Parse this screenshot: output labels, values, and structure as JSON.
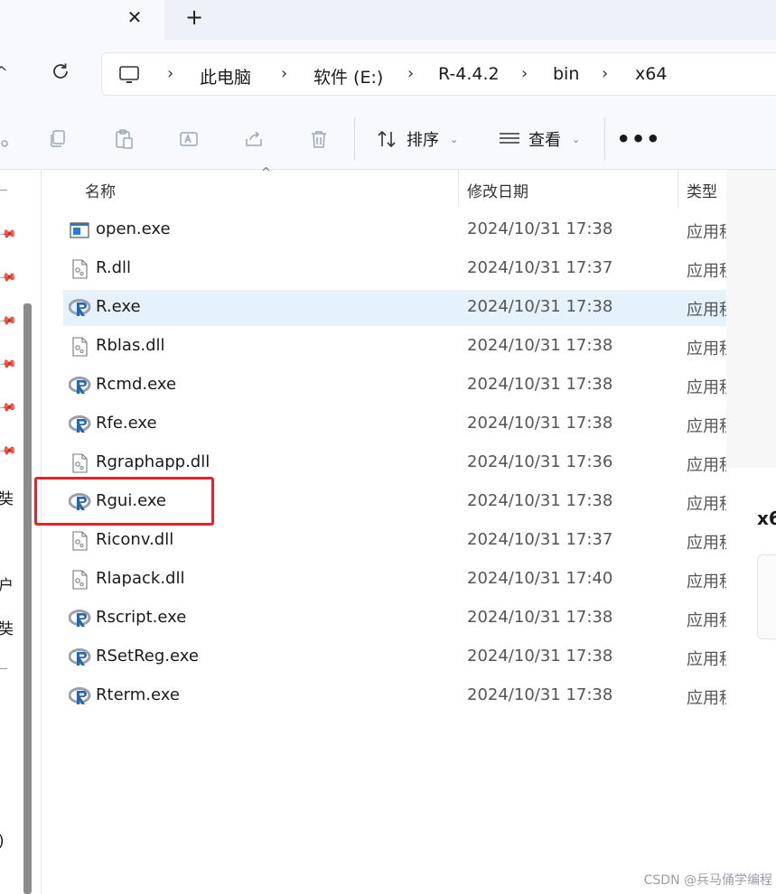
{
  "tabs": {
    "close_glyph": "✕",
    "new_tab_glyph": "+"
  },
  "address": {
    "left_fragment": "^",
    "breadcrumb": [
      "此电脑",
      "软件 (E:)",
      "R-4.4.2",
      "bin",
      "x64"
    ],
    "separator": "›"
  },
  "toolbar": {
    "sort_label": "排序",
    "view_label": "查看",
    "more_label": "•••"
  },
  "columns": {
    "name": "名称",
    "modified": "修改日期",
    "type": "类型"
  },
  "files": [
    {
      "name": "open.exe",
      "date": "2024/10/31 17:38",
      "type": "应用程序",
      "icon": "exe-window-icon"
    },
    {
      "name": "R.dll",
      "date": "2024/10/31 17:37",
      "type": "应用程序",
      "icon": "dll-icon"
    },
    {
      "name": "R.exe",
      "date": "2024/10/31 17:38",
      "type": "应用程序",
      "icon": "r-logo-icon",
      "selected": true
    },
    {
      "name": "Rblas.dll",
      "date": "2024/10/31 17:38",
      "type": "应用程序",
      "icon": "dll-icon"
    },
    {
      "name": "Rcmd.exe",
      "date": "2024/10/31 17:38",
      "type": "应用程序",
      "icon": "r-logo-icon"
    },
    {
      "name": "Rfe.exe",
      "date": "2024/10/31 17:38",
      "type": "应用程序",
      "icon": "r-logo-icon"
    },
    {
      "name": "Rgraphapp.dll",
      "date": "2024/10/31 17:36",
      "type": "应用程序",
      "icon": "dll-icon"
    },
    {
      "name": "Rgui.exe",
      "date": "2024/10/31 17:38",
      "type": "应用程序",
      "icon": "r-logo-icon",
      "highlighted": true
    },
    {
      "name": "Riconv.dll",
      "date": "2024/10/31 17:37",
      "type": "应用程序",
      "icon": "dll-icon"
    },
    {
      "name": "Rlapack.dll",
      "date": "2024/10/31 17:40",
      "type": "应用程序",
      "icon": "dll-icon"
    },
    {
      "name": "Rscript.exe",
      "date": "2024/10/31 17:38",
      "type": "应用程序",
      "icon": "r-logo-icon"
    },
    {
      "name": "RSetReg.exe",
      "date": "2024/10/31 17:38",
      "type": "应用程序",
      "icon": "r-logo-icon"
    },
    {
      "name": "Rterm.exe",
      "date": "2024/10/31 17:38",
      "type": "应用程序",
      "icon": "r-logo-icon"
    }
  ],
  "nav_fragments": [
    "奘",
    "户",
    "奘",
    ")"
  ],
  "details_pane": {
    "title_fragment": "x6"
  },
  "watermark": "CSDN @兵马俑学编程",
  "colors": {
    "selection": "#e5f1fb",
    "highlight_box": "#e8222a",
    "r_logo_blue": "#2266b8"
  }
}
